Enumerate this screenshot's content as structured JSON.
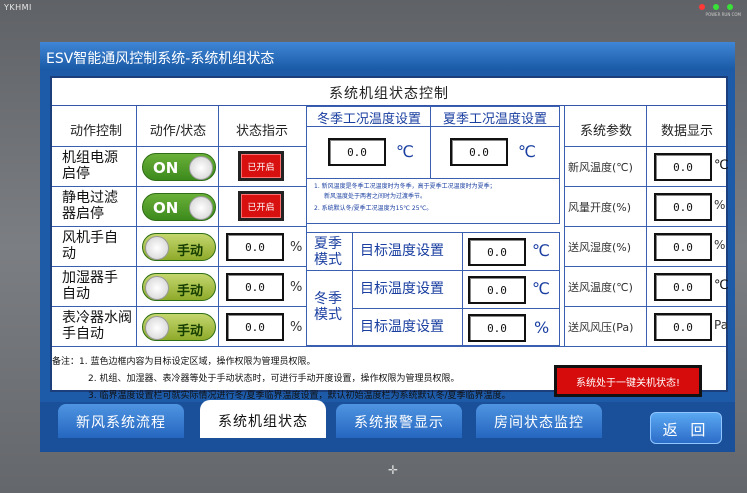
{
  "device": {
    "brand": "YKHMI",
    "led_labels": "POWER RUN COM"
  },
  "title": "ESV智能通风控制系统-系统机组状态",
  "panel_title": "系统机组状态控制",
  "left": {
    "headers": [
      "动作控制",
      "动作/状态",
      "状态指示"
    ],
    "rows": [
      {
        "label": "机组电源启停",
        "toggle": "ON",
        "indicator": "已开启"
      },
      {
        "label": "静电过滤器启停",
        "toggle": "ON",
        "indicator": "已开启"
      },
      {
        "label": "风机手自动",
        "toggle": "手动",
        "value": "0.0",
        "unit": "%"
      },
      {
        "label": "加湿器手自动",
        "toggle": "手动",
        "value": "0.0",
        "unit": "%"
      },
      {
        "label": "表冷器水阀手自动",
        "toggle": "手动",
        "value": "0.0",
        "unit": "%"
      }
    ]
  },
  "middle": {
    "winter_header": "冬季工况温度设置",
    "summer_header": "夏季工况温度设置",
    "winter_value": "0.0",
    "summer_value": "0.0",
    "temp_unit": "℃",
    "note1": "1. 新风温度是冬季工况温度时为冬季，高于夏季工况温度时为夏季；",
    "note1b": "新风温度处于两者之间时为过渡季节。",
    "note2": "2. 系统默认冬/夏季工况温度为15℃  25℃。",
    "summer_mode": "夏季模式",
    "winter_mode": "冬季模式",
    "target_label": "目标温度设置",
    "summer_target": "0.0",
    "winter_target1": "0.0",
    "winter_target2": "0.0",
    "pct_unit": "%"
  },
  "right": {
    "headers": [
      "系统参数",
      "数据显示"
    ],
    "rows": [
      {
        "label": "新风温度(℃)",
        "value": "0.0",
        "unit": "℃"
      },
      {
        "label": "风量开度(%)",
        "value": "0.0",
        "unit": "%"
      },
      {
        "label": "送风湿度(%)",
        "value": "0.0",
        "unit": "%"
      },
      {
        "label": "送风温度(℃)",
        "value": "0.0",
        "unit": "℃"
      },
      {
        "label": "送风风压(Pa)",
        "value": "0.0",
        "unit": "Pa"
      }
    ]
  },
  "notes": [
    "备注：1. 蓝色边框内容为目标设定区域，操作权限为管理员权限。",
    "2. 机组、加湿器、表冷器等处于手动状态时，可进行手动开度设置，操作权限为管理员权限。",
    "3. 临界温度设置栏可就实际情况进行冬/夏季临界温度设置，默认初始温度栏为系统默认冬/夏季临界温度。"
  ],
  "alarm": "系统处于一键关机状态!",
  "tabs": [
    {
      "label": "新风系统流程",
      "active": false
    },
    {
      "label": "系统机组状态",
      "active": true
    },
    {
      "label": "系统报警显示",
      "active": false
    },
    {
      "label": "房间状态监控",
      "active": false
    }
  ],
  "back_label": "返 回",
  "colors": {
    "screen_bg": "#1d5aa8",
    "toggle_on": "#3c8a1c",
    "indicator_red": "#d81010",
    "grid_blue": "#3a5fb0"
  }
}
